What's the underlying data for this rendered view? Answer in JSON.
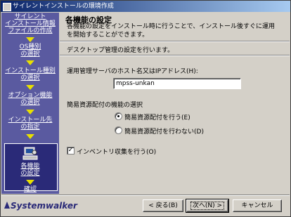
{
  "window": {
    "title": "サイレントインストールの環境作成"
  },
  "sidebar": {
    "steps": [
      {
        "label": "サイレント\nインストール情報\nファイルの作成"
      },
      {
        "label": "OS種別\nの選択"
      },
      {
        "label": "インストール種別\nの選択"
      },
      {
        "label": "オプション機能\nの選択"
      },
      {
        "label": "インストール先\nの指定"
      },
      {
        "label": "各機能\nの設定"
      },
      {
        "label": "確認"
      }
    ]
  },
  "main": {
    "title": "各機能の設定",
    "description": "各機能の設定をインストール時に行うことで、インストール後すぐに運用を開始することができます。",
    "subtitle": "デスクトップ管理の設定を行います。",
    "server_label": "運用管理サーバのホスト名又はIPアドレス(H):",
    "server_value": "mpss-unkan",
    "distribution_label": "簡易資源配付の機能の選択",
    "radio_yes": "簡易資源配付を行う(E)",
    "radio_no": "簡易資源配付を行わない(D)",
    "inventory_label": "インベントリ収集を行う(O)"
  },
  "footer": {
    "brand": "Systemwalker",
    "back": "< 戻る(B)",
    "next": "次へ(N) >",
    "cancel": "キャンセル"
  },
  "colors": {
    "sidebar": "#5a5aa0",
    "arrow": "#e8e000",
    "brand": "#2a2a78"
  }
}
